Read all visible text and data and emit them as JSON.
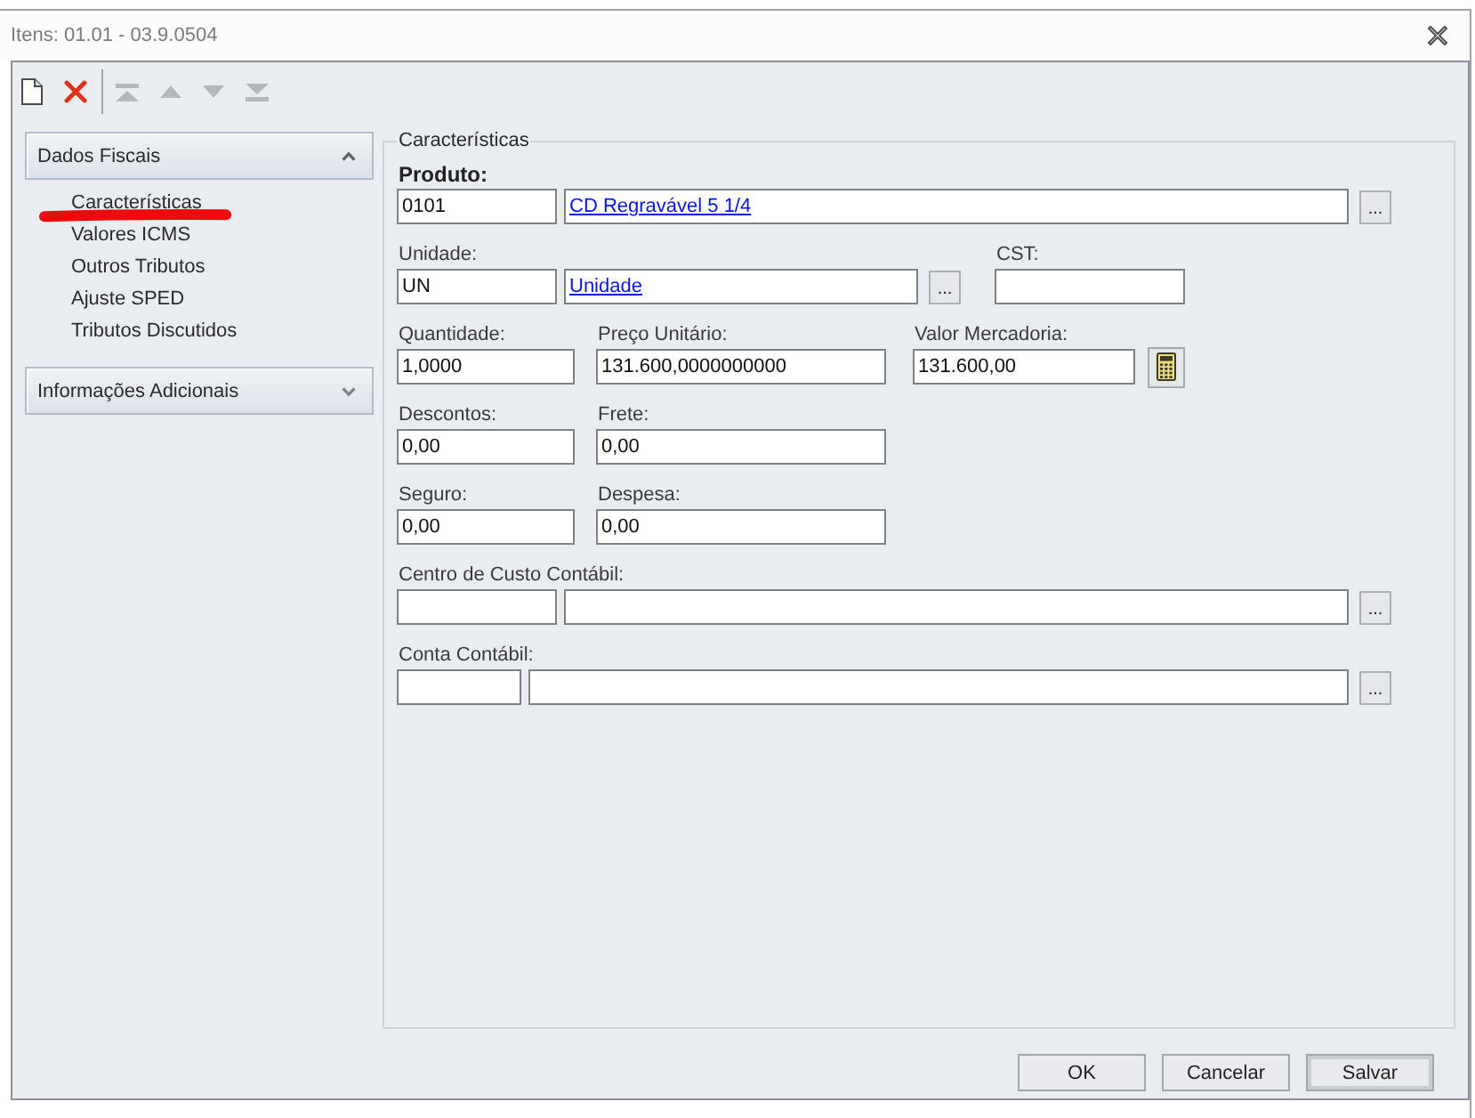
{
  "window": {
    "title": "Itens: 01.01 - 03.9.0504"
  },
  "toolbar": {
    "groups": [
      [
        {
          "kind": "new",
          "disabled": false
        },
        {
          "kind": "delete",
          "disabled": false
        }
      ],
      [
        {
          "kind": "first",
          "disabled": true
        },
        {
          "kind": "up",
          "disabled": true
        },
        {
          "kind": "down",
          "disabled": true
        },
        {
          "kind": "last",
          "disabled": true
        }
      ]
    ]
  },
  "sidebar": {
    "groups": [
      {
        "title": "Dados Fiscais",
        "expanded": true,
        "items": [
          {
            "label": "Características",
            "marked": true
          },
          {
            "label": "Valores ICMS",
            "marked": false
          },
          {
            "label": "Outros Tributos",
            "marked": false
          },
          {
            "label": "Ajuste SPED",
            "marked": false
          },
          {
            "label": "Tributos Discutidos",
            "marked": false
          }
        ]
      },
      {
        "title": "Informações Adicionais",
        "expanded": false
      }
    ]
  },
  "form": {
    "legend": "Características",
    "product": {
      "label": "Produto:",
      "code": "0101",
      "description": "CD Regravável 5 1/4",
      "browse": "..."
    },
    "unit": {
      "label": "Unidade:",
      "code": "UN",
      "description": "Unidade",
      "browse": "..."
    },
    "cst": {
      "label": "CST:"
    },
    "quantity": {
      "label": "Quantidade:",
      "value": "1,0000"
    },
    "unit_price": {
      "label": "Preço Unitário:",
      "value": "131.600,0000000000"
    },
    "merchandise_value": {
      "label": "Valor Mercadoria:",
      "value": "131.600,00"
    },
    "discounts": {
      "label": "Descontos:",
      "value": "0,00"
    },
    "freight": {
      "label": "Frete:",
      "value": "0,00"
    },
    "insurance": {
      "label": "Seguro:",
      "value": "0,00"
    },
    "expense": {
      "label": "Despesa:",
      "value": "0,00"
    },
    "cost_center": {
      "label": "Centro de Custo Contábil:",
      "browse": "..."
    },
    "account": {
      "label": "Conta Contábil:",
      "browse": "..."
    }
  },
  "buttons": [
    {
      "label": "OK",
      "default": false
    },
    {
      "label": "Cancelar",
      "default": false
    },
    {
      "label": "Salvar",
      "default": true
    }
  ]
}
